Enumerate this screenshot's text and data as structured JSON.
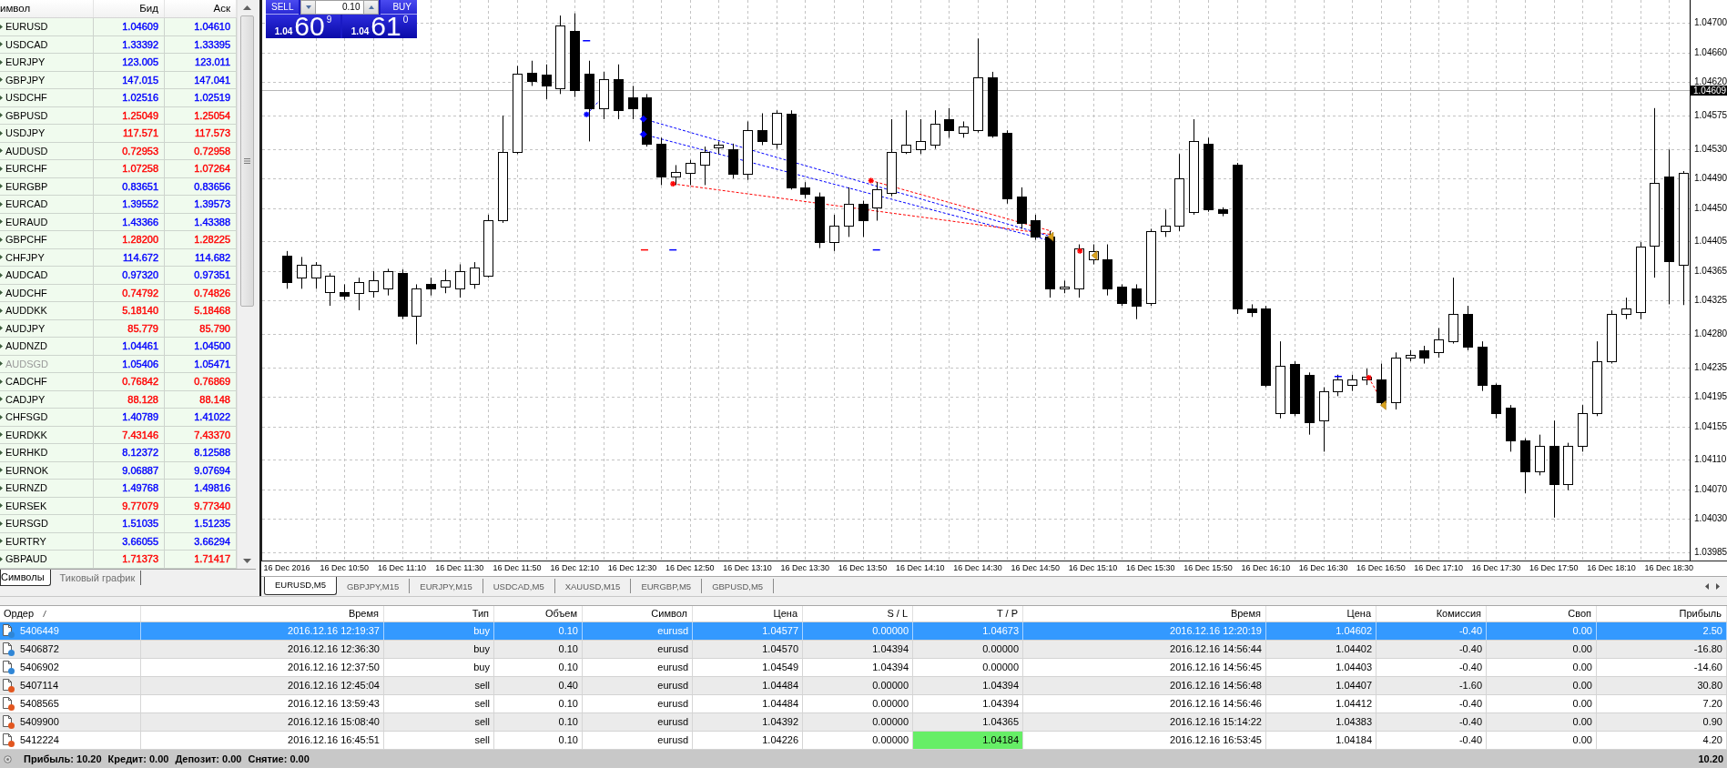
{
  "market_watch": {
    "columns": [
      "имвол",
      "Бид",
      "Аск"
    ],
    "rows": [
      {
        "symbol": "EURUSD",
        "bid": "1.04609",
        "ask": "1.04610",
        "color": "#0000ff",
        "disabled": false
      },
      {
        "symbol": "USDCAD",
        "bid": "1.33392",
        "ask": "1.33395",
        "color": "#0000ff",
        "disabled": false
      },
      {
        "symbol": "EURJPY",
        "bid": "123.005",
        "ask": "123.011",
        "color": "#0000ff",
        "disabled": false
      },
      {
        "symbol": "GBPJPY",
        "bid": "147.015",
        "ask": "147.041",
        "color": "#0000ff",
        "disabled": false
      },
      {
        "symbol": "USDCHF",
        "bid": "1.02516",
        "ask": "1.02519",
        "color": "#0000ff",
        "disabled": false
      },
      {
        "symbol": "GBPUSD",
        "bid": "1.25049",
        "ask": "1.25054",
        "color": "#ff0000",
        "disabled": false
      },
      {
        "symbol": "USDJPY",
        "bid": "117.571",
        "ask": "117.573",
        "color": "#ff0000",
        "disabled": false
      },
      {
        "symbol": "AUDUSD",
        "bid": "0.72953",
        "ask": "0.72958",
        "color": "#ff0000",
        "disabled": false
      },
      {
        "symbol": "EURCHF",
        "bid": "1.07258",
        "ask": "1.07264",
        "color": "#ff0000",
        "disabled": false
      },
      {
        "symbol": "EURGBP",
        "bid": "0.83651",
        "ask": "0.83656",
        "color": "#0000ff",
        "disabled": false
      },
      {
        "symbol": "EURCAD",
        "bid": "1.39552",
        "ask": "1.39573",
        "color": "#0000ff",
        "disabled": false
      },
      {
        "symbol": "EURAUD",
        "bid": "1.43366",
        "ask": "1.43388",
        "color": "#0000ff",
        "disabled": false
      },
      {
        "symbol": "GBPCHF",
        "bid": "1.28200",
        "ask": "1.28225",
        "color": "#ff0000",
        "disabled": false
      },
      {
        "symbol": "CHFJPY",
        "bid": "114.672",
        "ask": "114.682",
        "color": "#0000ff",
        "disabled": false
      },
      {
        "symbol": "AUDCAD",
        "bid": "0.97320",
        "ask": "0.97351",
        "color": "#0000ff",
        "disabled": false
      },
      {
        "symbol": "AUDCHF",
        "bid": "0.74792",
        "ask": "0.74826",
        "color": "#ff0000",
        "disabled": false
      },
      {
        "symbol": "AUDDKK",
        "bid": "5.18140",
        "ask": "5.18468",
        "color": "#ff0000",
        "disabled": false
      },
      {
        "symbol": "AUDJPY",
        "bid": "85.779",
        "ask": "85.790",
        "color": "#ff0000",
        "disabled": false
      },
      {
        "symbol": "AUDNZD",
        "bid": "1.04461",
        "ask": "1.04500",
        "color": "#0000ff",
        "disabled": false
      },
      {
        "symbol": "AUDSGD",
        "bid": "1.05406",
        "ask": "1.05471",
        "color": "#0000ff",
        "disabled": true
      },
      {
        "symbol": "CADCHF",
        "bid": "0.76842",
        "ask": "0.76869",
        "color": "#ff0000",
        "disabled": false
      },
      {
        "symbol": "CADJPY",
        "bid": "88.128",
        "ask": "88.148",
        "color": "#ff0000",
        "disabled": false
      },
      {
        "symbol": "CHFSGD",
        "bid": "1.40789",
        "ask": "1.41022",
        "color": "#0000ff",
        "disabled": false
      },
      {
        "symbol": "EURDKK",
        "bid": "7.43146",
        "ask": "7.43370",
        "color": "#ff0000",
        "disabled": false
      },
      {
        "symbol": "EURHKD",
        "bid": "8.12372",
        "ask": "8.12588",
        "color": "#0000ff",
        "disabled": false
      },
      {
        "symbol": "EURNOK",
        "bid": "9.06887",
        "ask": "9.07694",
        "color": "#0000ff",
        "disabled": false
      },
      {
        "symbol": "EURNZD",
        "bid": "1.49768",
        "ask": "1.49816",
        "color": "#0000ff",
        "disabled": false
      },
      {
        "symbol": "EURSEK",
        "bid": "9.77079",
        "ask": "9.77340",
        "color": "#ff0000",
        "disabled": false
      },
      {
        "symbol": "EURSGD",
        "bid": "1.51035",
        "ask": "1.51235",
        "color": "#0000ff",
        "disabled": false
      },
      {
        "symbol": "EURTRY",
        "bid": "3.66055",
        "ask": "3.66294",
        "color": "#0000ff",
        "disabled": false
      },
      {
        "symbol": "GBPAUD",
        "bid": "1.71373",
        "ask": "1.71417",
        "color": "#ff0000",
        "disabled": false
      }
    ],
    "tabs": [
      {
        "label": "Символы",
        "selected": true
      },
      {
        "label": "Тиковый график",
        "selected": false
      }
    ]
  },
  "trade_panel": {
    "sell": {
      "label": "SELL",
      "prefix": "1.04",
      "main": "60",
      "last": "9"
    },
    "lot": "0.10",
    "buy": {
      "label": "BUY",
      "prefix": "1.04",
      "main": "61",
      "last": "0"
    }
  },
  "chart": {
    "chart_data": {
      "type": "candlestick",
      "grid": true,
      "categories": [
        "16 Dec 2016",
        null,
        null,
        null,
        "16 Dec 10:50",
        null,
        null,
        null,
        "16 Dec 11:10",
        null,
        null,
        null,
        "16 Dec 11:30",
        null,
        null,
        null,
        "16 Dec 11:50",
        null,
        null,
        null,
        "16 Dec 12:10",
        null,
        null,
        null,
        "16 Dec 12:30",
        null,
        null,
        null,
        "16 Dec 12:50",
        null,
        null,
        null,
        "16 Dec 13:10",
        null,
        null,
        null,
        "16 Dec 13:30",
        null,
        null,
        null,
        "16 Dec 13:50",
        null,
        null,
        null,
        "16 Dec 14:10",
        null,
        null,
        null,
        "16 Dec 14:30",
        null,
        null,
        null,
        "16 Dec 14:50",
        null,
        null,
        null,
        "16 Dec 15:10",
        null,
        null,
        null,
        "16 Dec 15:30",
        null,
        null,
        null,
        "16 Dec 15:50",
        null,
        null,
        null,
        "16 Dec 16:10",
        null,
        null,
        null,
        "16 Dec 16:30",
        null,
        null,
        null,
        "16 Dec 16:50",
        null,
        null,
        null,
        "16 Dec 17:10",
        null,
        null,
        null,
        "16 Dec 17:30",
        null,
        null,
        null,
        "16 Dec 17:50",
        null,
        null,
        null,
        "16 Dec 18:10",
        null,
        null,
        null,
        "16 Dec 18:30",
        null
      ],
      "ohlc": [
        [
          1.04386,
          1.04392,
          1.04341,
          1.0435
        ],
        [
          1.04356,
          1.04384,
          1.04341,
          1.04373
        ],
        [
          1.04356,
          1.04377,
          1.04341,
          1.04374
        ],
        [
          1.04337,
          1.04362,
          1.04318,
          1.04359
        ],
        [
          1.04337,
          1.04347,
          1.04326,
          1.04332
        ],
        [
          1.04335,
          1.04356,
          1.04312,
          1.0435
        ],
        [
          1.04338,
          1.04365,
          1.04329,
          1.04353
        ],
        [
          1.04341,
          1.04368,
          1.04332,
          1.04365
        ],
        [
          1.04362,
          1.04367,
          1.043,
          1.04304
        ],
        [
          1.04304,
          1.04347,
          1.04266,
          1.04341
        ],
        [
          1.04347,
          1.04356,
          1.04332,
          1.04341
        ],
        [
          1.04344,
          1.04367,
          1.04335,
          1.04352
        ],
        [
          1.04341,
          1.04374,
          1.04329,
          1.04365
        ],
        [
          1.04347,
          1.04377,
          1.04341,
          1.0437
        ],
        [
          1.04359,
          1.04441,
          1.04356,
          1.04433
        ],
        [
          1.04433,
          1.04575,
          1.0443,
          1.04526
        ],
        [
          1.04526,
          1.04642,
          1.04523,
          1.04631
        ],
        [
          1.04633,
          1.04649,
          1.04615,
          1.04622
        ],
        [
          1.0463,
          1.04644,
          1.04597,
          1.04615
        ],
        [
          1.04612,
          1.0471,
          1.04604,
          1.04697
        ],
        [
          1.04689,
          1.04713,
          1.046,
          1.04609
        ],
        [
          1.04631,
          1.04649,
          1.0454,
          1.04585
        ],
        [
          1.04585,
          1.04634,
          1.0457,
          1.04624
        ],
        [
          1.04624,
          1.04644,
          1.0457,
          1.04582
        ],
        [
          1.046,
          1.04615,
          1.0457,
          1.04585
        ],
        [
          1.046,
          1.04604,
          1.04533,
          1.04537
        ],
        [
          1.04537,
          1.04545,
          1.04481,
          1.04493
        ],
        [
          1.04493,
          1.04508,
          1.04481,
          1.04499
        ],
        [
          1.04497,
          1.04515,
          1.04481,
          1.04511
        ],
        [
          1.04508,
          1.04533,
          1.04481,
          1.04526
        ],
        [
          1.04532,
          1.0454,
          1.04523,
          1.04535
        ],
        [
          1.0453,
          1.04537,
          1.0449,
          1.04496
        ],
        [
          1.04496,
          1.04567,
          1.04488,
          1.04555
        ],
        [
          1.04555,
          1.04578,
          1.04535,
          1.0454
        ],
        [
          1.04537,
          1.04582,
          1.0453,
          1.04579
        ],
        [
          1.04578,
          1.04582,
          1.04475,
          1.04478
        ],
        [
          1.04478,
          1.04485,
          1.04463,
          1.04469
        ],
        [
          1.04466,
          1.04471,
          1.04396,
          1.04404
        ],
        [
          1.04404,
          1.04441,
          1.04392,
          1.04426
        ],
        [
          1.04426,
          1.04478,
          1.04411,
          1.04456
        ],
        [
          1.04456,
          1.0446,
          1.04411,
          1.04433
        ],
        [
          1.04451,
          1.04485,
          1.04433,
          1.04475
        ],
        [
          1.04471,
          1.0457,
          1.04466,
          1.04526
        ],
        [
          1.04526,
          1.04582,
          1.04523,
          1.04535
        ],
        [
          1.0453,
          1.0457,
          1.04523,
          1.0454
        ],
        [
          1.04535,
          1.04582,
          1.0453,
          1.04564
        ],
        [
          1.0457,
          1.04585,
          1.04545,
          1.04555
        ],
        [
          1.04552,
          1.04567,
          1.04545,
          1.0456
        ],
        [
          1.04555,
          1.04679,
          1.04552,
          1.04627
        ],
        [
          1.04627,
          1.04634,
          1.04545,
          1.04548
        ],
        [
          1.04552,
          1.04555,
          1.04456,
          1.04463
        ],
        [
          1.04466,
          1.04478,
          1.04422,
          1.0443
        ],
        [
          1.04433,
          1.04441,
          1.04407,
          1.04411
        ],
        [
          1.04411,
          1.04419,
          1.04329,
          1.04341
        ],
        [
          1.04341,
          1.04352,
          1.04335,
          1.04344
        ],
        [
          1.04341,
          1.04401,
          1.04329,
          1.04396
        ],
        [
          1.04381,
          1.04401,
          1.04374,
          1.04392
        ],
        [
          1.04381,
          1.04401,
          1.04332,
          1.04341
        ],
        [
          1.04344,
          1.04347,
          1.04318,
          1.04322
        ],
        [
          1.04341,
          1.04347,
          1.043,
          1.04318
        ],
        [
          1.04322,
          1.04422,
          1.04318,
          1.04419
        ],
        [
          1.04419,
          1.04448,
          1.04411,
          1.04426
        ],
        [
          1.04426,
          1.04523,
          1.04419,
          1.0449
        ],
        [
          1.04445,
          1.0457,
          1.04441,
          1.0454
        ],
        [
          1.04537,
          1.04545,
          1.04445,
          1.04448
        ],
        [
          1.04448,
          1.04451,
          1.04439,
          1.04444
        ],
        [
          1.04508,
          1.04511,
          1.04307,
          1.04315
        ],
        [
          1.04315,
          1.0432,
          1.04303,
          1.04309
        ],
        [
          1.04315,
          1.04318,
          1.04208,
          1.04211
        ],
        [
          1.04173,
          1.0427,
          1.04166,
          1.04237
        ],
        [
          1.0424,
          1.04243,
          1.04169,
          1.04173
        ],
        [
          1.04225,
          1.04228,
          1.04144,
          1.04161
        ],
        [
          1.04163,
          1.04208,
          1.04121,
          1.04203
        ],
        [
          1.04203,
          1.04225,
          1.04196,
          1.04218
        ],
        [
          1.04211,
          1.04225,
          1.04203,
          1.04218
        ],
        [
          1.04218,
          1.04233,
          1.04211,
          1.04222
        ],
        [
          1.04218,
          1.0424,
          1.04184,
          1.04188
        ],
        [
          1.04188,
          1.04255,
          1.04178,
          1.04248
        ],
        [
          1.04248,
          1.04258,
          1.04243,
          1.04252
        ],
        [
          1.04258,
          1.04264,
          1.0424,
          1.04248
        ],
        [
          1.04255,
          1.04288,
          1.04248,
          1.04273
        ],
        [
          1.0427,
          1.04356,
          1.04267,
          1.04307
        ],
        [
          1.04307,
          1.04318,
          1.04258,
          1.04263
        ],
        [
          1.04263,
          1.0427,
          1.04203,
          1.04211
        ],
        [
          1.04211,
          1.04213,
          1.04166,
          1.04173
        ],
        [
          1.04181,
          1.04184,
          1.04121,
          1.04136
        ],
        [
          1.04136,
          1.04139,
          1.04065,
          1.04095
        ],
        [
          1.04095,
          1.04144,
          1.04089,
          1.04129
        ],
        [
          1.04129,
          1.04163,
          1.04032,
          1.04077
        ],
        [
          1.04077,
          1.04133,
          1.04069,
          1.04129
        ],
        [
          1.04129,
          1.04184,
          1.04121,
          1.04173
        ],
        [
          1.04173,
          1.0427,
          1.04169,
          1.04243
        ],
        [
          1.04243,
          1.04312,
          1.0424,
          1.04307
        ],
        [
          1.04307,
          1.04329,
          1.043,
          1.04315
        ],
        [
          1.0431,
          1.04404,
          1.043,
          1.04398
        ],
        [
          1.04399,
          1.04585,
          1.04356,
          1.04484
        ],
        [
          1.04493,
          1.04529,
          1.0432,
          1.04378
        ],
        [
          1.04374,
          1.045,
          1.04319,
          1.04497
        ]
      ],
      "ylim": [
        1.03974,
        1.04731
      ],
      "yticks": [
        {
          "value": 1.047,
          "label": "1.04700"
        },
        {
          "value": 1.0466,
          "label": "1.04660"
        },
        {
          "value": 1.0462,
          "label": "1.04620"
        },
        {
          "value": 1.04575,
          "label": "1.04575"
        },
        {
          "value": 1.0453,
          "label": "1.04530"
        },
        {
          "value": 1.0449,
          "label": "1.04490"
        },
        {
          "value": 1.0445,
          "label": "1.04450"
        },
        {
          "value": 1.04405,
          "label": "1.04405"
        },
        {
          "value": 1.04365,
          "label": "1.04365"
        },
        {
          "value": 1.04325,
          "label": "1.04325"
        },
        {
          "value": 1.0428,
          "label": "1.04280"
        },
        {
          "value": 1.04235,
          "label": "1.04235"
        },
        {
          "value": 1.04195,
          "label": "1.04195"
        },
        {
          "value": 1.04155,
          "label": "1.04155"
        },
        {
          "value": 1.0411,
          "label": "1.04110"
        },
        {
          "value": 1.0407,
          "label": "1.04070"
        },
        {
          "value": 1.0403,
          "label": "1.04030"
        },
        {
          "value": 1.03985,
          "label": "1.03985"
        }
      ],
      "ref_lines": [
        {
          "axis": "y",
          "value": 1.04609,
          "label": "1.04609"
        }
      ]
    }
  },
  "chart_tabs": [
    {
      "label": "EURUSD,M5",
      "selected": true
    },
    {
      "label": "GBPJPY,M15",
      "selected": false
    },
    {
      "label": "EURJPY,M15",
      "selected": false
    },
    {
      "label": "USDCAD,M5",
      "selected": false
    },
    {
      "label": "XAUUSD,M15",
      "selected": false
    },
    {
      "label": "EURGBP,M5",
      "selected": false
    },
    {
      "label": "GBPUSD,M5",
      "selected": false
    }
  ],
  "orders": {
    "columns": [
      "Ордер",
      "Время",
      "Тип",
      "Объем",
      "Символ",
      "Цена",
      "S / L",
      "T / P",
      "Время",
      "Цена",
      "Комиссия",
      "Своп",
      "Прибыль"
    ],
    "rows": [
      {
        "cells": [
          "5406449",
          "2016.12.16 12:19:37",
          "buy",
          "0.10",
          "eurusd",
          "1.04577",
          "0.00000",
          "1.04673",
          "2016.12.16 12:20:19",
          "1.04602",
          "-0.40",
          "0.00",
          "2.50"
        ],
        "selected": true,
        "tp_highlighted": false,
        "color": "#2f86d6"
      },
      {
        "cells": [
          "5406872",
          "2016.12.16 12:36:30",
          "buy",
          "0.10",
          "eurusd",
          "1.04570",
          "1.04394",
          "0.00000",
          "2016.12.16 14:56:44",
          "1.04402",
          "-0.40",
          "0.00",
          "-16.80"
        ],
        "selected": false,
        "tp_highlighted": false,
        "color": "#2f86d6"
      },
      {
        "cells": [
          "5406902",
          "2016.12.16 12:37:50",
          "buy",
          "0.10",
          "eurusd",
          "1.04549",
          "1.04394",
          "0.00000",
          "2016.12.16 14:56:45",
          "1.04403",
          "-0.40",
          "0.00",
          "-14.60"
        ],
        "selected": false,
        "tp_highlighted": false,
        "color": "#2f86d6"
      },
      {
        "cells": [
          "5407114",
          "2016.12.16 12:45:04",
          "sell",
          "0.40",
          "eurusd",
          "1.04484",
          "0.00000",
          "1.04394",
          "2016.12.16 14:56:48",
          "1.04407",
          "-1.60",
          "0.00",
          "30.80"
        ],
        "selected": false,
        "tp_highlighted": false,
        "color": "#e2561f"
      },
      {
        "cells": [
          "5408565",
          "2016.12.16 13:59:43",
          "sell",
          "0.10",
          "eurusd",
          "1.04484",
          "0.00000",
          "1.04394",
          "2016.12.16 14:56:46",
          "1.04412",
          "-0.40",
          "0.00",
          "7.20"
        ],
        "selected": false,
        "tp_highlighted": false,
        "color": "#e2561f"
      },
      {
        "cells": [
          "5409900",
          "2016.12.16 15:08:40",
          "sell",
          "0.10",
          "eurusd",
          "1.04392",
          "0.00000",
          "1.04365",
          "2016.12.16 15:14:22",
          "1.04383",
          "-0.40",
          "0.00",
          "0.90"
        ],
        "selected": false,
        "tp_highlighted": false,
        "color": "#e2561f"
      },
      {
        "cells": [
          "5412224",
          "2016.12.16 16:45:51",
          "sell",
          "0.10",
          "eurusd",
          "1.04226",
          "0.00000",
          "1.04184",
          "2016.12.16 16:53:45",
          "1.04184",
          "-0.40",
          "0.00",
          "4.20"
        ],
        "selected": false,
        "tp_highlighted": true,
        "color": "#e2561f"
      }
    ],
    "summary": {
      "items": [
        "Прибыль: 10.20",
        "Кредит: 0.00",
        "Депозит: 0.00",
        "Снятие: 0.00"
      ],
      "total": "10.20"
    }
  }
}
